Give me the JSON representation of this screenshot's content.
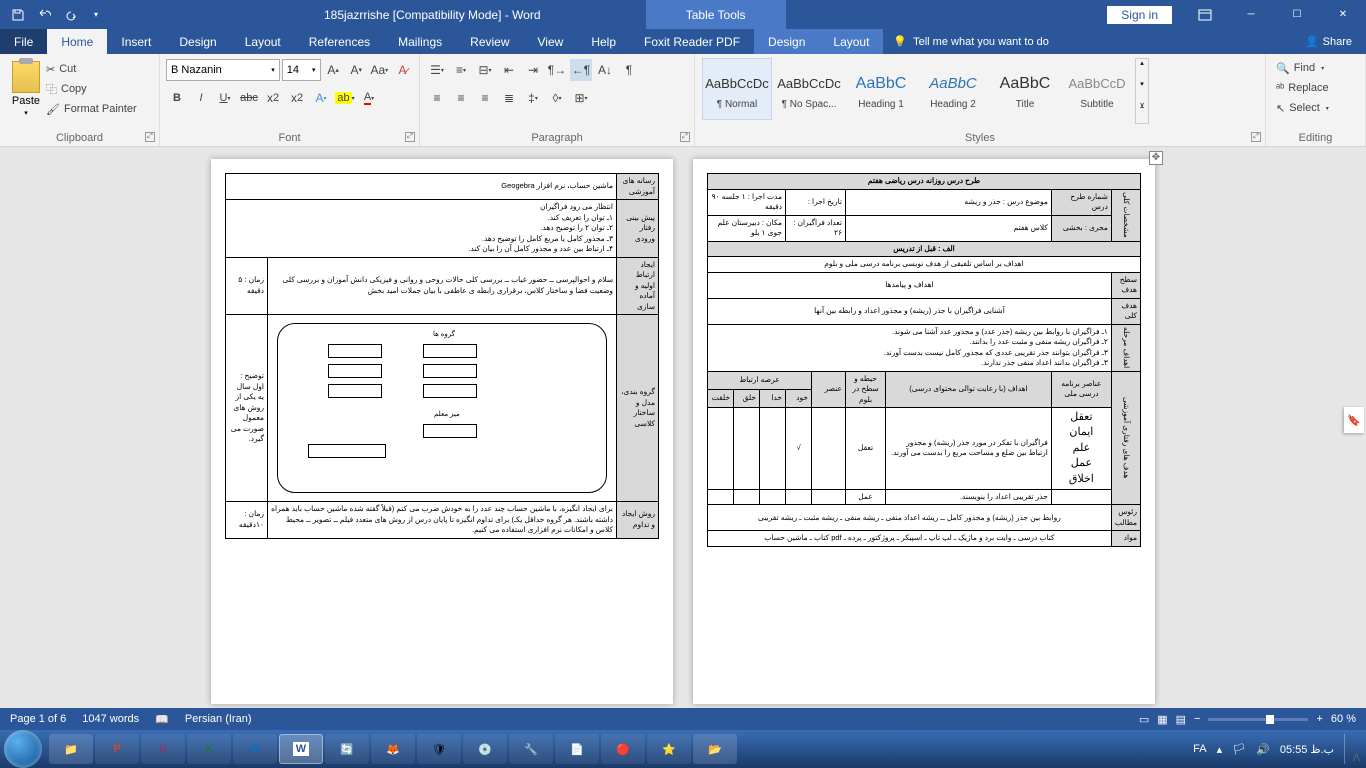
{
  "titlebar": {
    "doc_title": "185jazrrishe [Compatibility Mode]  -  Word",
    "table_tools": "Table Tools",
    "sign_in": "Sign in"
  },
  "tabs": {
    "file": "File",
    "home": "Home",
    "insert": "Insert",
    "design": "Design",
    "layout": "Layout",
    "references": "References",
    "mailings": "Mailings",
    "review": "Review",
    "view": "View",
    "help": "Help",
    "foxit": "Foxit Reader PDF",
    "t_design": "Design",
    "t_layout": "Layout",
    "tell_me": "Tell me what you want to do",
    "share": "Share"
  },
  "clipboard": {
    "paste": "Paste",
    "cut": "Cut",
    "copy": "Copy",
    "format_painter": "Format Painter",
    "label": "Clipboard"
  },
  "font": {
    "name": "B Nazanin",
    "size": "14",
    "label": "Font"
  },
  "paragraph": {
    "label": "Paragraph"
  },
  "styles": {
    "label": "Styles",
    "items": [
      {
        "preview": "AaBbCcDc",
        "name": "¶ Normal"
      },
      {
        "preview": "AaBbCcDc",
        "name": "¶ No Spac..."
      },
      {
        "preview": "AaBbC",
        "name": "Heading 1"
      },
      {
        "preview": "AaBbC",
        "name": "Heading 2"
      },
      {
        "preview": "AaBbC",
        "name": "Title"
      },
      {
        "preview": "AaBbCcD",
        "name": "Subtitle"
      }
    ]
  },
  "editing": {
    "find": "Find",
    "replace": "Replace",
    "select": "Select",
    "label": "Editing"
  },
  "status": {
    "page": "Page 1 of 6",
    "words": "1047 words",
    "lang": "Persian (Iran)",
    "zoom": "60 %"
  },
  "tray": {
    "lang": "FA",
    "time": "ب.ظ 05:55"
  },
  "doc": {
    "header": "طرح درس روزانه درس ریاضی هفتم",
    "r1": {
      "c1": "شماره طرح درس",
      "c2": "موضوع درس : جذر و ریشه",
      "c3": "تاریخ اجرا :",
      "c4": "مدت اجرا : ۱ جلسه ۹۰ دقیقه"
    },
    "r2": {
      "c1": "مجری : بخشی",
      "c2": "کلاس هفتم",
      "c3": "تعداد فراگیران : ۲۶",
      "c4": "مکان : دبیرستان علم جوی ۱ بلو"
    },
    "side1": "مشخصات کلی",
    "sec_a": "الف : قبل از تدریس",
    "goals_title": "اهداف بر اساس تلفیقی از هدف نویسی برنامه درسی ملی و بلوم",
    "level_goal_h": "سطح هدف",
    "level_goal": "اهداف و پیامدها",
    "gen_goal_h": "هدف کلی",
    "gen_goal": "آشنایی فراگیران با جذر (ریشه) و مجذور اعداد و رابطه بین آنها",
    "stage_h": "اهداف مرحله",
    "stage_goals": "۱ـ فراگیران با روابط بین ریشه (جذر عدد) و مجذور عدد آشنا می شوند.\n۲ـ فراگیران ریشه منفی و مثبت عدد را بدانند.\n۳ـ فراگیران بتوانند جذر تقریبی عددی که مجذور کامل نیست بدست آورند.\n۳ـ فراگیران بدانند اعداد منفی جذر ندارند.",
    "side2": "هدف های رفتاری آموزشی",
    "tbl_h": {
      "c1": "عناصر برنامه درسی ملی",
      "c2": "اهداف (با رعایت توالی محتوای درسی)",
      "c3": "حیطه و سطح در بلوم",
      "c4": "عرصه ارتباط"
    },
    "tbl_sub": {
      "c1": "عنصر",
      "c2": "خود",
      "c3": "خدا",
      "c4": "خلق",
      "c5": "خلقت"
    },
    "vals": {
      "v1": "تعقل",
      "v2": "ایمان",
      "v3": "علم",
      "v4": "عمل",
      "v5": "اخلاق"
    },
    "row_a": {
      "t": "فراگیران با تفکر در مورد جذر (ریشه) و مجذور ارتباط بین ضلع و مساحت مربع را بدست می آورند.",
      "d": "تعقل",
      "m": "√"
    },
    "row_b": {
      "t": "جذر تقریبی اعداد را بنویسند.",
      "d": "عمل"
    },
    "outline_h": "رئوس مطالب",
    "outline": "روابط بین جذر (ریشه) و مجذور کامل ــ ریشه اعداد منفی ـ ریشه منفی ـ ریشه مثبت ـ ریشه تقریبی",
    "mat_h": "مواد",
    "materials": "کتاب درسی ـ وایت برد و ماژیک ـ لپ تاپ ـ اسپیکر ـ پروژکتور ـ پرده ـ pdf کتاب ـ ماشین حساب",
    "p2": {
      "media_h": "رسانه های آموزشی",
      "media": "ماشین حساب، نرم افزار Geogebra",
      "pre_h": "پیش بینی رفتار ورودی",
      "pre": "انتظار می رود فراگیران\n۱ـ توان را تعریف کند.\n۲ـ توان ۲ را توضیح دهد.\n۳ـ مجذور کامل یا مربع کامل را توضیح دهد.\n۴ـ ارتباط بین عدد و مجذور کامل آن را بیان کند.",
      "prep_h": "ایجاد ارتباط اولیه و آماده سازی",
      "prep": "سلام و احوالپرسی ــ حضور غیاب ــ بررسی کلی حالات روحی و روانی و فیزیکی دانش آموزان و بررسی کلی وضعیت فضا و ساختار کلاس، برقراری رابطه ی عاطفی با بیان جملات امید بخش",
      "prep_time": "زمان : ۵ دقیقه",
      "layout_h": "گروه بندی، مدل و ساختار کلاسی",
      "layout_note": "توضیح : اول سال یه یکی از روش های معمول صورت می گیرد.",
      "groups": "گروه ها",
      "teacher_desk": "میز معلم",
      "motiv_h": "روش ایجاد و تداوم",
      "motiv": "برای ایجاد انگیزه، با ماشین حساب چند عدد را به خودش ضرب می کنم (قبلاً گفته شده ماشین حساب باید همراه داشته باشند. هر گروه حداقل یکـ) برای تداوم انگیزه تا پایان درس از روش های متعدد فیلم ــ تصویر ــ محیط کلاس و امکانات نرم افزاری استفاده می کنیم.",
      "motiv_time": "زمان : ۱۰دقیقه"
    }
  }
}
